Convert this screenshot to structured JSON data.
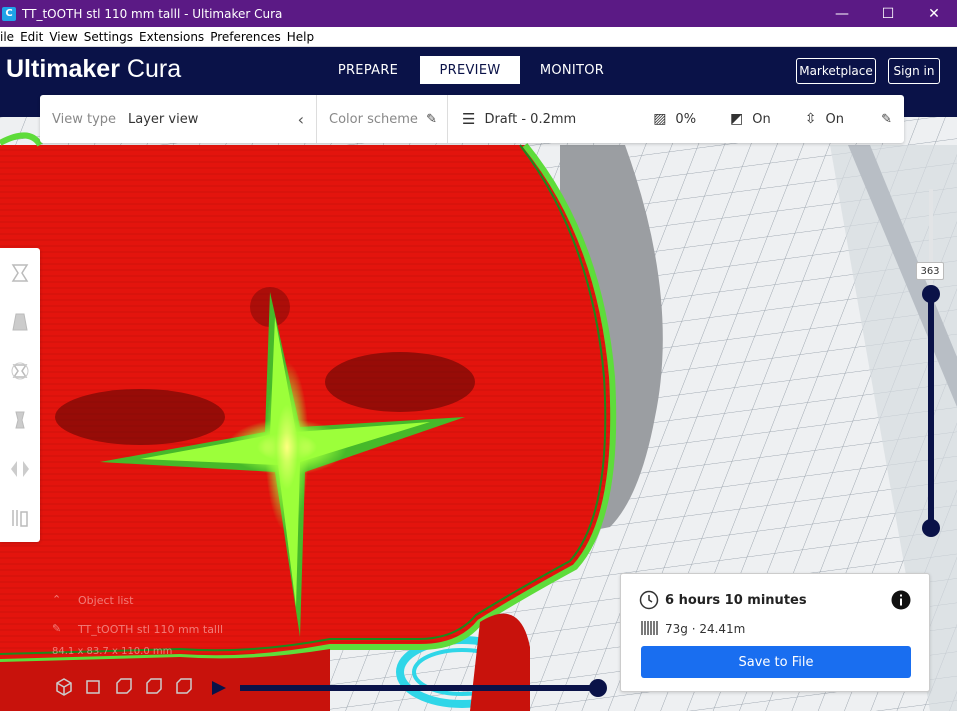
{
  "window": {
    "title": "TT_tOOTH stl  110 mm talll - Ultimaker Cura",
    "app_icon_letter": "C",
    "controls": {
      "minimize": "—",
      "maximize": "☐",
      "close": "✕"
    }
  },
  "menu": [
    "ile",
    "Edit",
    "View",
    "Settings",
    "Extensions",
    "Preferences",
    "Help"
  ],
  "header": {
    "brand_bold": "Ultimaker",
    "brand_light": "Cura",
    "tabs": [
      {
        "label": "PREPARE",
        "active": false
      },
      {
        "label": "PREVIEW",
        "active": true
      },
      {
        "label": "MONITOR",
        "active": false
      }
    ],
    "marketplace_label": "Marketplace",
    "signin_label": "Sign in"
  },
  "view_options": {
    "view_type_label": "View type",
    "view_type_value": "Layer view",
    "color_scheme_label": "Color scheme",
    "profile": "Draft - 0.2mm",
    "infill": "0%",
    "support": "On",
    "adhesion": "On"
  },
  "layer_slider": {
    "current_layer": "363"
  },
  "object_list": {
    "title": "Object list",
    "object_name": "TT_tOOTH stl  110 mm talll",
    "dimensions": "84.1 x 83.7 x 110.0 mm"
  },
  "print_info": {
    "time": "6 hours 10 minutes",
    "material": "73g · 24.41m",
    "save_label": "Save to File"
  },
  "colors": {
    "title_bar": "#5b1a85",
    "header": "#0a1248",
    "accent_button": "#196ef0",
    "model_wall": "#e8150e",
    "model_infill": "#9cff3a"
  }
}
